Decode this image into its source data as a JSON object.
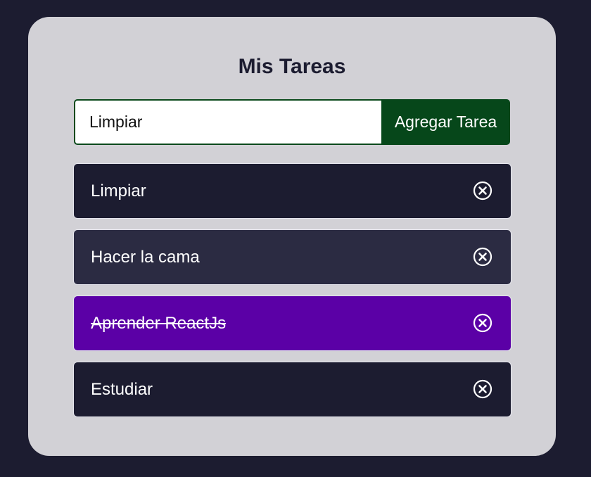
{
  "header": {
    "title": "Mis Tareas"
  },
  "form": {
    "input_value": "Limpiar",
    "button_label": "Agregar Tarea"
  },
  "tasks": [
    {
      "text": "Limpiar",
      "completed": false,
      "color": "#1c1c30",
      "icon": "close-circle-icon"
    },
    {
      "text": "Hacer la cama",
      "completed": false,
      "color": "#2b2b42",
      "icon": "close-circle-icon"
    },
    {
      "text": "Aprender ReactJs",
      "completed": true,
      "color": "#5b00a6",
      "icon": "close-circle-icon"
    },
    {
      "text": "Estudiar",
      "completed": false,
      "color": "#1c1c30",
      "icon": "close-circle-icon"
    }
  ],
  "colors": {
    "page_background": "#1c1c30",
    "card_background": "#d2d1d6",
    "button_background": "#06471a"
  }
}
